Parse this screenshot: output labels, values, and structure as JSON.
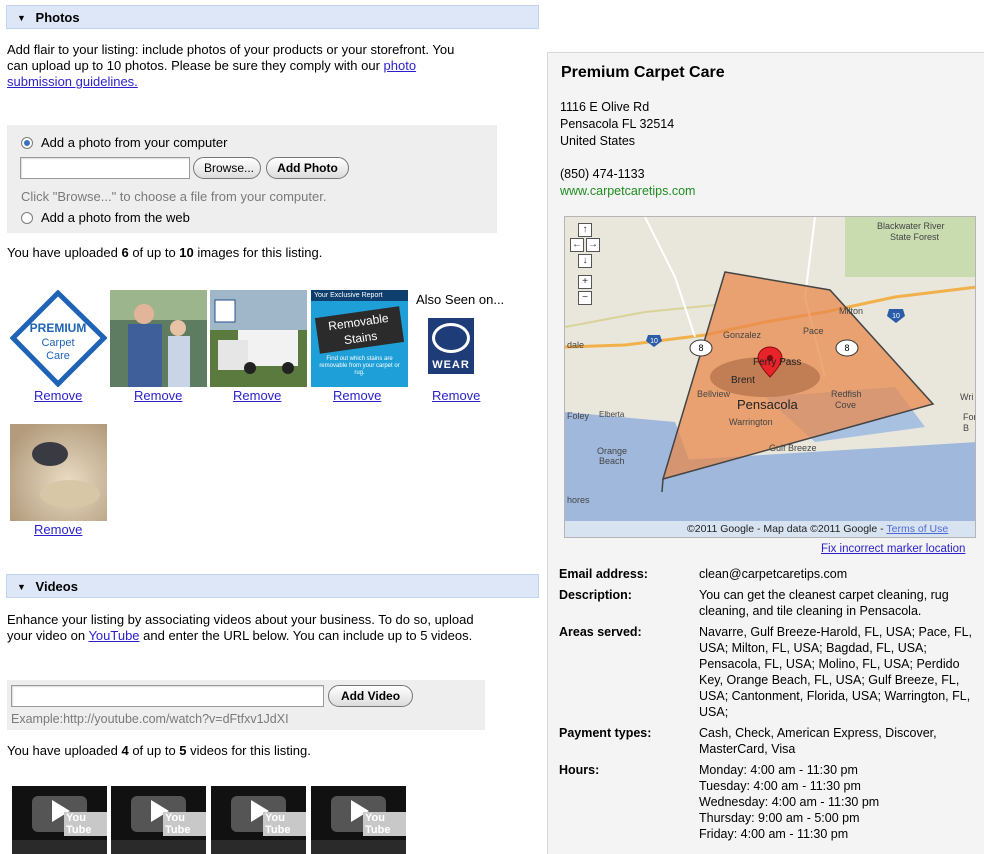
{
  "photos": {
    "header": "Photos",
    "intro_line1": "Add flair to your listing: include photos of your products or your storefront. You",
    "intro_line2_pre": "can upload up to 10 photos. Please be sure they comply with our ",
    "intro_link_a": "photo",
    "intro_link_b": "submission guidelines.",
    "option_computer": "Add a photo from your computer",
    "browse_label": "Browse...",
    "add_photo_label": "Add Photo",
    "browse_hint": "Click \"Browse...\" to choose a file from your computer.",
    "option_web": "Add a photo from the web",
    "uploaded_pre": "You have uploaded ",
    "uploaded_count": "6",
    "uploaded_mid": " of up to ",
    "uploaded_max": "10",
    "uploaded_post": " images for this listing.",
    "remove_label": "Remove",
    "logo_premium": "PREMIUM",
    "logo_carpet": "Carpet",
    "logo_care": "Care",
    "report_title": "Your Exclusive Report",
    "report_main1": "Removable",
    "report_main2": "Stains",
    "report_small": "Find out which stains are removable from your carpet or rug.",
    "also_seen": "Also Seen on...",
    "wear_label": "WEAR"
  },
  "videos": {
    "header": "Videos",
    "intro_line1": "Enhance your listing by associating videos about your business. To do so, upload",
    "intro_line2_pre": "your video on ",
    "intro_link": "YouTube",
    "intro_line2_post": " and enter the URL below. You can include up to 5 videos.",
    "add_video_label": "Add Video",
    "example": "Example:http://youtube.com/watch?v=dFtfxv1JdXI",
    "uploaded_pre": "You have uploaded ",
    "uploaded_count": "4",
    "uploaded_mid": " of up to ",
    "uploaded_max": "5",
    "uploaded_post": " videos for this listing.",
    "thumb_label": "You Tube"
  },
  "listing": {
    "name": "Premium Carpet Care",
    "address1": "1116 E Olive Rd",
    "address2": "Pensacola FL 32514",
    "address3": "United States",
    "phone": "(850) 474-1133",
    "website": "www.carpetcaretips.com",
    "map": {
      "copyright": "©2011 Google - Map data ©2011 Google - ",
      "terms_link": "Terms of Use",
      "fix_link": "Fix incorrect marker location",
      "labels": {
        "blackwater1": "Blackwater River",
        "blackwater2": "State Forest",
        "milton": "Milton",
        "gonzalez": "Gonzalez",
        "pace": "Pace",
        "ferry_pass": "Ferry Pass",
        "brent": "Brent",
        "bellview": "Bellview",
        "pensacola": "Pensacola",
        "redfish1": "Redfish",
        "redfish2": "Cove",
        "warrington": "Warrington",
        "foley": "Foley",
        "elberta": "Elberta",
        "gulf_breeze": "Gulf Breeze",
        "orange1": "Orange",
        "orange2": "Beach",
        "dale": "dale",
        "hores": "hores",
        "wri": "Wri",
        "fort1": "Fort",
        "fort2": "B",
        "i10a": "10",
        "i10b": "10",
        "r8a": "8",
        "r8b": "8"
      }
    },
    "details": [
      {
        "label": "Email address:",
        "value": "clean@carpetcaretips.com"
      },
      {
        "label": "Description:",
        "value": "You can get the cleanest carpet cleaning, rug cleaning, and tile cleaning in Pensacola."
      },
      {
        "label": "Areas served:",
        "value": "Navarre, Gulf Breeze-Harold, FL, USA; Pace, FL, USA; Milton, FL, USA; Bagdad, FL, USA; Pensacola, FL, USA; Molino, FL, USA; Perdido Key, Orange Beach, FL, USA; Gulf Breeze, FL, USA; Cantonment, Florida, USA; Warrington, FL, USA;"
      },
      {
        "label": "Payment types:",
        "value": "Cash, Check, American Express, Discover, MasterCard, Visa"
      },
      {
        "label": "Hours:",
        "value": ""
      }
    ],
    "hours": [
      "Monday: 4:00 am - 11:30 pm",
      "Tuesday: 4:00 am - 11:30 pm",
      "Wednesday: 4:00 am - 11:30 pm",
      "Thursday: 9:00 am - 5:00 pm",
      "Friday: 4:00 am - 11:30 pm"
    ]
  },
  "colors": {
    "section_bar": "#dde7f8",
    "link": "#2a1fc9",
    "website_green": "#1f8d1f",
    "service_area": "#e8894d"
  }
}
